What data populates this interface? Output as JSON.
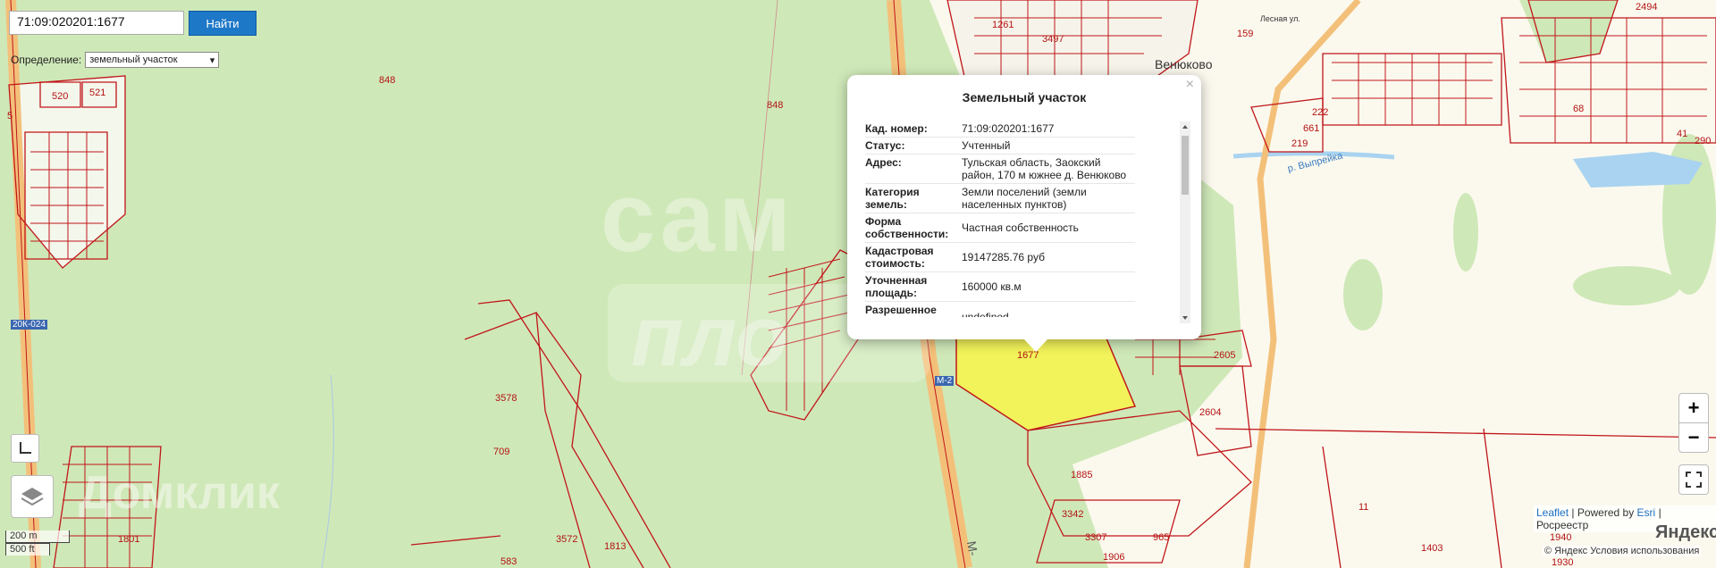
{
  "search": {
    "value": "71:09:020201:1677",
    "button_label": "Найти"
  },
  "definition": {
    "label": "Определение:",
    "selected": "земельный участок"
  },
  "popup": {
    "title": "Земельный участок",
    "close": "×",
    "rows": [
      {
        "key": "Кад. номер:",
        "value": "71:09:020201:1677"
      },
      {
        "key": "Статус:",
        "value": "Учтенный"
      },
      {
        "key": "Адрес:",
        "value": "Тульская область, Заокский район, 170 м южнее д. Венюково"
      },
      {
        "key": "Категория земель:",
        "value": "Земли поселений (земли населенных пунктов)"
      },
      {
        "key": "Форма собственности:",
        "value": "Частная собственность"
      },
      {
        "key": "Кадастровая стоимость:",
        "value": "19147285.76 руб"
      },
      {
        "key": "Уточненная площадь:",
        "value": "160000 кв.м"
      },
      {
        "key": "Разрешенное",
        "value": "undefined"
      }
    ]
  },
  "map_labels": {
    "parcels": [
      "848",
      "848",
      "520",
      "521",
      "5",
      "1261",
      "3497",
      "159",
      "2494",
      "222",
      "661",
      "219",
      "2605",
      "2604",
      "1677",
      "3578",
      "709",
      "1885",
      "3342",
      "3307",
      "965",
      "1906",
      "3572",
      "1813",
      "583",
      "1801",
      "11",
      "1403",
      "1940",
      "1930",
      "290",
      "41",
      "68"
    ],
    "places": [
      "Венюково"
    ],
    "roads": [
      "20К-024",
      "М-2",
      "М-"
    ],
    "river": "р. Выпрейка",
    "street": "Лесная ул."
  },
  "watermarks": [
    "сам",
    "пло",
    "Домклик"
  ],
  "controls": {
    "zoom_in": "+",
    "zoom_out": "−"
  },
  "scale": {
    "metric": "200 m",
    "imperial": "500 ft"
  },
  "attribution": {
    "leaflet": "Leaflet",
    "powered": "| Powered by",
    "esri": "Esri",
    "rosreestr": "| Росреестр"
  },
  "yandex": {
    "logo": "Яндекс",
    "terms": "© Яндекс  Условия использования"
  },
  "colors": {
    "boundary": "#c0161a",
    "forest": "#cfe8b8",
    "field": "#fbf9ee",
    "selected": "#f2f25a",
    "water": "#a9d3f0",
    "button": "#1e78c8"
  }
}
